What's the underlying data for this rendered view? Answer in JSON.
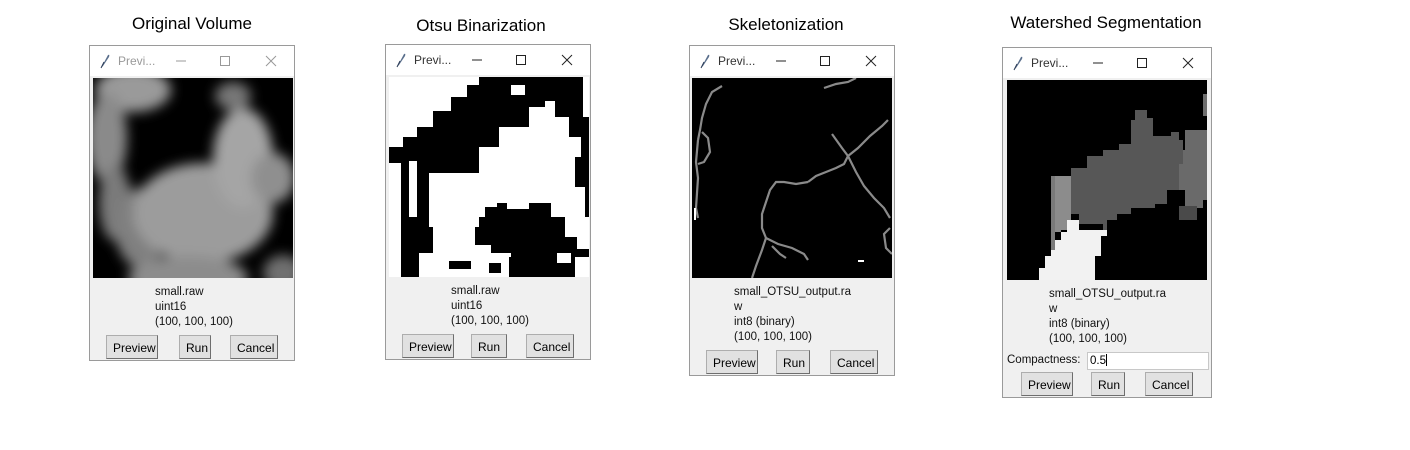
{
  "panels": [
    {
      "heading": "Original Volume",
      "window_title": "Previ...",
      "info": [
        "small.raw",
        "uint16",
        "(100, 100, 100)"
      ],
      "buttons": {
        "preview": "Preview",
        "run": "Run",
        "cancel": "Cancel"
      }
    },
    {
      "heading": "Otsu Binarization",
      "window_title": "Previ...",
      "info": [
        "small.raw",
        "uint16",
        "(100, 100, 100)"
      ],
      "buttons": {
        "preview": "Preview",
        "run": "Run",
        "cancel": "Cancel"
      }
    },
    {
      "heading": "Skeletonization",
      "window_title": "Previ...",
      "info": [
        "small_OTSU_output.ra",
        "w",
        "int8  (binary)",
        "(100, 100, 100)"
      ],
      "buttons": {
        "preview": "Preview",
        "run": "Run",
        "cancel": "Cancel"
      }
    },
    {
      "heading": "Watershed Segmentation",
      "window_title": "Previ...",
      "info": [
        "small_OTSU_output.ra",
        "w",
        "int8  (binary)",
        "(100, 100, 100)"
      ],
      "compactness": {
        "label": "Compactness:",
        "value": "0.5"
      },
      "buttons": {
        "preview": "Preview",
        "run": "Run",
        "cancel": "Cancel"
      }
    }
  ],
  "icons": {
    "window_icon": "feather-icon",
    "minimize": "minimize-icon",
    "maximize": "maximize-icon",
    "close": "close-icon"
  },
  "colors": {
    "window_bg": "#f0f0f0",
    "view_bg": "#000000",
    "skeleton_line": "#8a8a8a",
    "title_text": "#999999"
  }
}
